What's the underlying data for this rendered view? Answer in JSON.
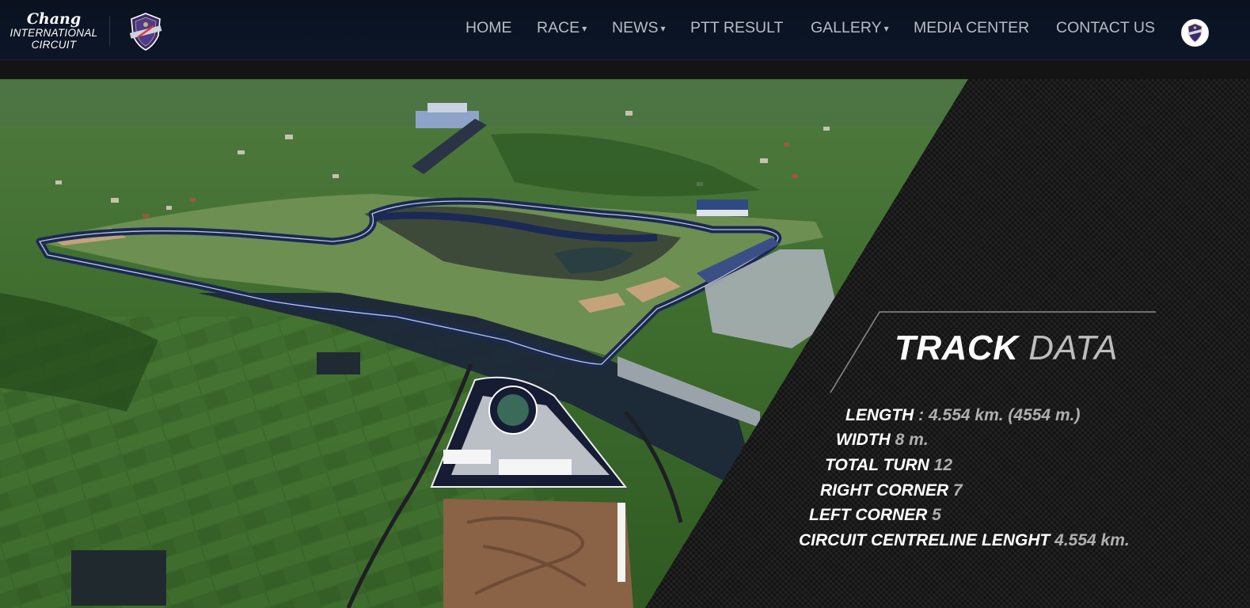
{
  "brand": {
    "name": "Chang",
    "line1": "INTERNATIONAL",
    "line2": "CIRCUIT",
    "badge_icon": "buriram-united-badge-icon"
  },
  "nav": {
    "items": [
      {
        "label": "HOME",
        "dropdown": false
      },
      {
        "label": "RACE",
        "dropdown": true
      },
      {
        "label": "NEWS",
        "dropdown": true
      },
      {
        "label": "PTT RESULT",
        "dropdown": false
      },
      {
        "label": "GALLERY",
        "dropdown": true
      },
      {
        "label": "MEDIA CENTER",
        "dropdown": false
      },
      {
        "label": "CONTACT US",
        "dropdown": false
      }
    ],
    "caret": "▾",
    "avatar_icon": "language-badge-icon"
  },
  "track_data": {
    "title_bold": "TRACK",
    "title_light": "DATA",
    "specs": [
      {
        "label": "LENGTH",
        "value": ": 4.554 km. (4554 m.)"
      },
      {
        "label": "WIDTH",
        "value": "8 m."
      },
      {
        "label": "TOTAL TURN",
        "value": "12"
      },
      {
        "label": "RIGHT CORNER",
        "value": "7"
      },
      {
        "label": "LEFT CORNER",
        "value": "5"
      },
      {
        "label": "CIRCUIT CENTRELINE LENGHT",
        "value": "4.554 km."
      }
    ]
  },
  "colors": {
    "nav_background": "#0b1424",
    "nav_text": "#b7bcc6",
    "panel_background": "#1a1a1a",
    "track_asphalt": "#1a2a55"
  }
}
